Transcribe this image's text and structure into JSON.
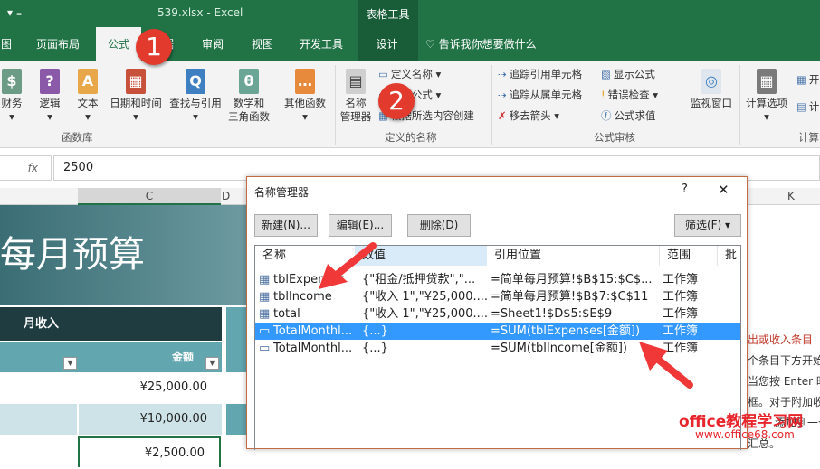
{
  "window": {
    "filename": "539.xlsx",
    "sep": "-",
    "app": "Excel",
    "context_tab": "表格工具"
  },
  "tabs": [
    "图",
    "页面布局",
    "公式",
    "数据",
    "审阅",
    "视图",
    "开发工具",
    "设计"
  ],
  "tell_me": "告诉我你想要做什么",
  "ribbon": {
    "func_lib": [
      {
        "label": "财务",
        "glyph": "$"
      },
      {
        "label": "逻辑",
        "glyph": "?"
      },
      {
        "label": "文本",
        "glyph": "A"
      },
      {
        "label": "日期和时间",
        "glyph": "▦"
      },
      {
        "label": "查找与引用",
        "glyph": "Q"
      },
      {
        "label": "数学和\n三角函数",
        "glyph": "θ"
      },
      {
        "label": "其他函数",
        "glyph": "…"
      }
    ],
    "func_lib_group": "函数库",
    "name_manager": "名称\n管理器",
    "define_name": "定义名称",
    "use_in_formula": "用于公式",
    "create_from_selection": "根据所选内容创建",
    "names_group": "定义的名称",
    "trace_precedents": "追踪引用单元格",
    "trace_dependents": "追踪从属单元格",
    "remove_arrows": "移去箭头",
    "show_formulas": "显示公式",
    "error_checking": "错误检查",
    "evaluate_formula": "公式求值",
    "watch_window": "监视窗口",
    "audit_group": "公式审核",
    "calc_options": "计算选项",
    "calc_group": "计算",
    "calc_now": "开",
    "calc_sheet": "计"
  },
  "formula_bar": {
    "fx": "fx",
    "value": "2500"
  },
  "columns": [
    "C",
    "D",
    "K"
  ],
  "sheet": {
    "title": "每月预算",
    "income_header": "月收入",
    "amount_header": "金额",
    "amounts": [
      "¥25,000.00",
      "¥10,000.00",
      "¥2,500.00"
    ]
  },
  "right_text": [
    "出或收入条目",
    "个条目下方开始",
    "当您按 Enter 时",
    "框。对于附加收",
    "添加到一个",
    "汇总。"
  ],
  "dialog": {
    "title": "名称管理器",
    "help": "?",
    "close": "✕",
    "new": "新建(N)...",
    "edit": "编辑(E)...",
    "delete": "删除(D)",
    "filter": "筛选(F) ▾",
    "headers": [
      "名称",
      "数值",
      "引用位置",
      "范围",
      "批"
    ],
    "rows": [
      {
        "name": "tblExpenses",
        "value": "{\"租金/抵押贷款\",\"...",
        "ref": "=简单每月预算!$B$15:$C$...",
        "scope": "工作簿",
        "icon": "table-icon"
      },
      {
        "name": "tblIncome",
        "value": "{\"收入 1\",\"¥25,000....",
        "ref": "=简单每月预算!$B$7:$C$11",
        "scope": "工作簿",
        "icon": "table-icon"
      },
      {
        "name": "total",
        "value": "{\"收入 1\",\"¥25,000....",
        "ref": "=Sheet1!$D$5:$E$9",
        "scope": "工作簿",
        "icon": "table-icon"
      },
      {
        "name": "TotalMonthl...",
        "value": "{...}",
        "ref": "=SUM(tblExpenses[金额])",
        "scope": "工作簿",
        "icon": "name-icon",
        "selected": true
      },
      {
        "name": "TotalMonthl...",
        "value": "{...}",
        "ref": "=SUM(tblIncome[金额])",
        "scope": "工作簿",
        "icon": "name-icon"
      }
    ]
  },
  "callouts": [
    "1",
    "2"
  ],
  "watermark": {
    "line1": "office教程学习网",
    "line2": "www.office68.com"
  },
  "colors": {
    "excel_green": "#217346",
    "accent": "#e33a2e",
    "selection": "#3399ff"
  }
}
